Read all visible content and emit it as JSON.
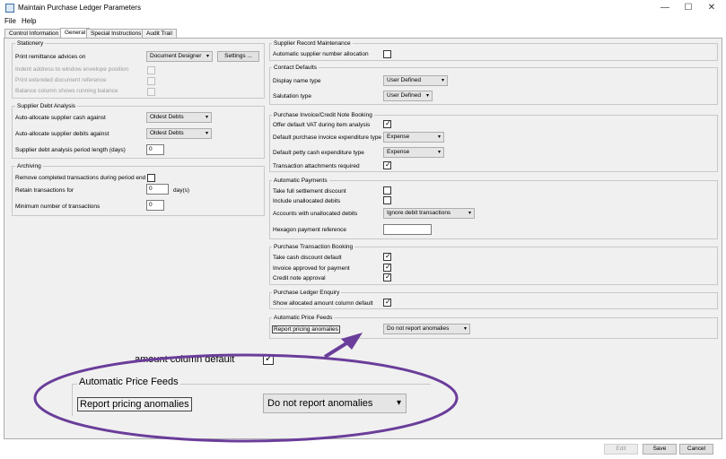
{
  "window": {
    "title": "Maintain Purchase Ledger Parameters",
    "minimize": "—",
    "maximize": "☐",
    "close": "✕"
  },
  "menu": [
    "File",
    "Help"
  ],
  "tabs": [
    "Control Information",
    "General",
    "Special Instructions",
    "Audit Trail"
  ],
  "left": {
    "stationery": {
      "title": "Stationery",
      "print_remittance_label": "Print remittance advices on",
      "print_remittance_value": "Document Designer",
      "settings_button": "Settings ...",
      "indent_address": "Indent address to window envelope position",
      "print_extended": "Print extended document reference",
      "balance_column": "Balance column shows running balance"
    },
    "debt_analysis": {
      "title": "Supplier Debt Analysis",
      "auto_cash_label": "Auto-allocate supplier cash against",
      "auto_cash_value": "Oldest Debts",
      "auto_debits_label": "Auto-allocate supplier debits against",
      "auto_debits_value": "Oldest Debts",
      "period_length_label": "Supplier debt analysis period length (days)",
      "period_length_value": "0"
    },
    "archiving": {
      "title": "Archiving",
      "remove_completed": "Remove completed transactions during period end",
      "retain_label": "Retain transactions for",
      "retain_value": "0",
      "retain_unit": "day(s)",
      "min_label": "Minimum number of transactions",
      "min_value": "0"
    }
  },
  "right": {
    "supplier_record": {
      "title": "Supplier Record Maintenance",
      "auto_number": "Automatic supplier number allocation"
    },
    "contact_defaults": {
      "title": "Contact Defaults",
      "display_name_label": "Display name type",
      "display_name_value": "User Defined",
      "salutation_label": "Salutation type",
      "salutation_value": "User Defined"
    },
    "invoice_booking": {
      "title": "Purchase Invoice/Credit Note Booking",
      "offer_vat": "Offer default VAT during item analysis",
      "default_expenditure_label": "Default purchase invoice expenditure type",
      "default_expenditure_value": "Expense",
      "petty_cash_label": "Default petty cash expenditure type",
      "petty_cash_value": "Expense",
      "attachments": "Transaction attachments required"
    },
    "auto_payments": {
      "title": "Automatic Payments",
      "full_settlement": "Take full settlement discount",
      "include_unallocated": "Include unallocated debits",
      "accounts_label": "Accounts with unallocated debits",
      "accounts_value": "Ignore debit transactions",
      "hexagon_label": "Hexagon payment reference"
    },
    "transaction_booking": {
      "title": "Purchase Transaction Booking",
      "cash_discount": "Take cash discount default",
      "invoice_approved": "Invoice approved for payment",
      "credit_note": "Credit note approval"
    },
    "ledger_enquiry": {
      "title": "Purchase Ledger Enquiry",
      "show_allocated": "Show allocated amount column default"
    },
    "price_feeds": {
      "title": "Automatic Price Feeds",
      "report_label": "Report pricing anomalies",
      "report_value": "Do not report anomalies"
    }
  },
  "zoom": {
    "partial_label": "amount column default",
    "title": "Automatic Price Feeds",
    "report_label": "Report pricing anomalies",
    "report_value": "Do not report anomalies"
  },
  "buttons": {
    "edit": "Edit",
    "save": "Save",
    "cancel": "Cancel"
  },
  "colors": {
    "callout": "#6a3d9a",
    "tick": "✓",
    "arrow": "▾"
  }
}
